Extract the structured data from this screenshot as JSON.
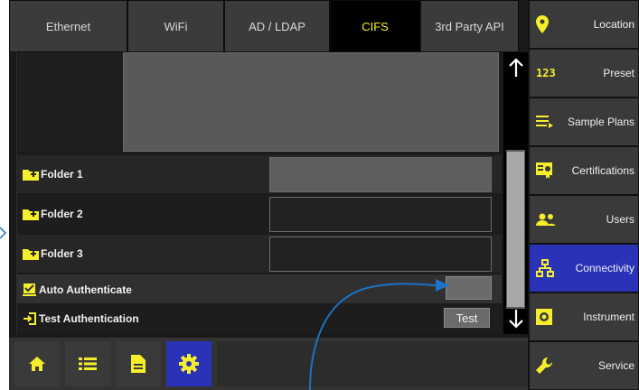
{
  "tabs": [
    {
      "label": "Ethernet",
      "active": false
    },
    {
      "label": "WiFi",
      "active": false
    },
    {
      "label": "AD / LDAP",
      "active": false
    },
    {
      "label": "CIFS",
      "active": true
    },
    {
      "label": "3rd Party API",
      "active": false
    }
  ],
  "rows": {
    "folder1": {
      "label": "Folder 1",
      "value": ""
    },
    "folder2": {
      "label": "Folder 2",
      "value": ""
    },
    "folder3": {
      "label": "Folder 3",
      "value": ""
    },
    "auto_auth": {
      "label": "Auto Authenticate",
      "checked": false
    },
    "test_auth": {
      "label": "Test Authentication",
      "button": "Test"
    }
  },
  "bottom_nav": [
    "home-icon",
    "list-icon",
    "document-icon",
    "gear-icon"
  ],
  "sidebar": [
    {
      "label": "Location",
      "icon": "location-pin-icon",
      "active": false
    },
    {
      "label": "Preset",
      "icon": "123-icon",
      "active": false
    },
    {
      "label": "Sample Plans",
      "icon": "playlist-icon",
      "active": false
    },
    {
      "label": "Certifications",
      "icon": "certificate-icon",
      "active": false
    },
    {
      "label": "Users",
      "icon": "users-icon",
      "active": false
    },
    {
      "label": "Connectivity",
      "icon": "network-icon",
      "active": true
    },
    {
      "label": "Instrument",
      "icon": "instrument-icon",
      "active": false
    },
    {
      "label": "Service",
      "icon": "wrench-icon",
      "active": false
    }
  ],
  "colors": {
    "accent": "#f5ee2c",
    "active": "#2a32b8",
    "annotation": "#1a73c4"
  }
}
